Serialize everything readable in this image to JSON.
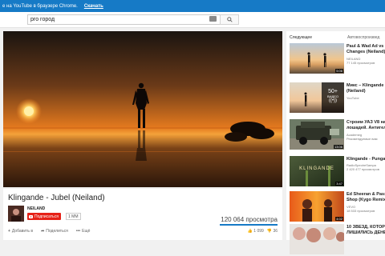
{
  "promo": {
    "text": "е на YouTube в браузере Chrome.",
    "link": "Скачать"
  },
  "search": {
    "value": "pro город"
  },
  "video": {
    "title": "Klingande - Jubel (Neiland)",
    "channel": "NEILAND",
    "subscribe_label": "Подписаться",
    "subscriber_count": "1 MM",
    "views": "120 064 просмотра",
    "actions": {
      "add": "Добавить в",
      "share": "Поделиться",
      "more": "Ещё"
    },
    "likes": "1 099",
    "dislikes": "36"
  },
  "sidebar": {
    "heading": "Следующее",
    "autoplay": "Автовоспроизвед",
    "items": [
      {
        "title_1": "Paul & Wad Ad vs Nel",
        "title_2": "Changes (Neiland)",
        "meta_1": "NEILAND",
        "meta_2": "77 145 просмотров",
        "duration": "5:06"
      },
      {
        "title_1": "Микс – Klingande",
        "title_2": "(Neiland)",
        "meta_1": "YouTube",
        "meta_2": "",
        "duration": "",
        "badge_count": "50+",
        "badge_label": "ВИДЕО"
      },
      {
        "title_1": "Строим УАЗ V8 на",
        "title_2": "лошадей. Антигели",
        "meta_1": "Academeg",
        "meta_2": "Рекомендуемые вам",
        "duration": "13:06"
      },
      {
        "title_1": "Klingande - Punga",
        "title_2": "",
        "meta_1": "RadioSpectreSampa",
        "meta_2": "2 420 477 просмотров",
        "duration": "3:47",
        "thumb_text": "KLINGANDE"
      },
      {
        "title_1": "Ed Sheeran & Pass",
        "title_2": "Shop (Kygo Remix)",
        "meta_1": "VEVO",
        "meta_2": "18 533 просмотров",
        "duration": "4:02"
      },
      {
        "title_1": "10 ЗВЕЗД, КОТОР",
        "title_2": "ЛИШИЛИСЬ ДЕНЕ",
        "meta_1": "",
        "meta_2": "",
        "duration": ""
      }
    ]
  }
}
